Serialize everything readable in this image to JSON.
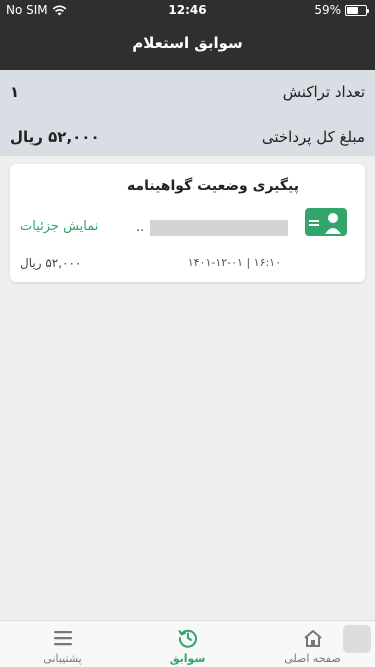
{
  "status_bar": {
    "carrier": "No SIM",
    "time": "12:46",
    "battery": "59%",
    "battery_level": 0.59
  },
  "header": {
    "title": "سوابق استعلام"
  },
  "summary": {
    "transactions_label": "تعداد تراکنش",
    "transactions_value": "۱",
    "total_label": "مبلغ کل پرداختی",
    "total_value": "۵۲,۰۰۰ ریال"
  },
  "card": {
    "title": "پیگیری وضعیت گواهینامه",
    "masked_suffix": "..",
    "details_link": "نمایش جزئیات",
    "datetime": "۱۶:۱۰ | ۱۴۰۱-۱۲-۰۱",
    "amount": "۵۲,۰۰۰ ریال",
    "icon_color": "#31a56a"
  },
  "tabbar": {
    "home": "صفحه اصلی",
    "history": "سوابق",
    "support": "پشتیبانی",
    "active_color": "#31a56a"
  }
}
